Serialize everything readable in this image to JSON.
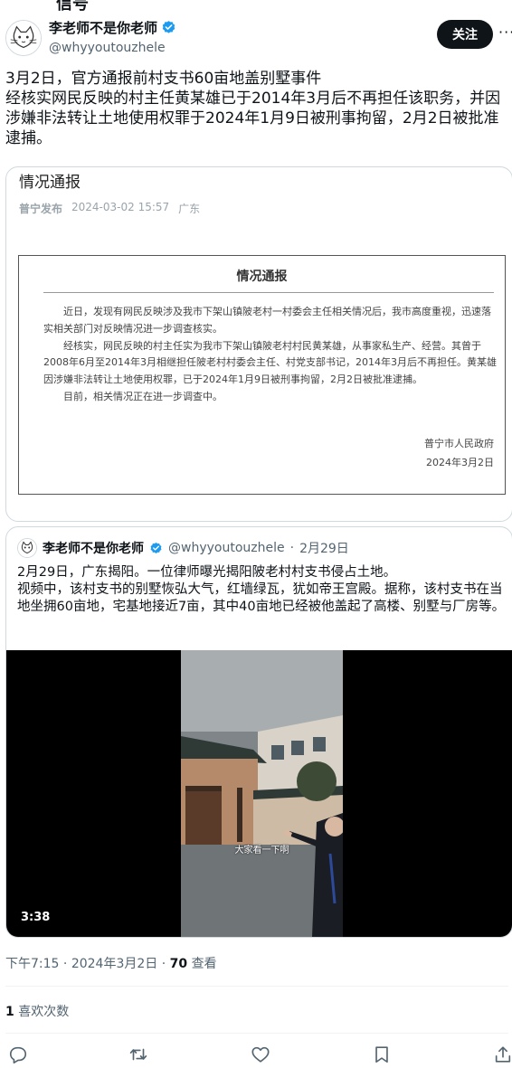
{
  "colors": {
    "text": "#0f1419",
    "secondary": "#536471",
    "verified": "#1d9bf0",
    "border": "#cfd9de"
  },
  "header_cut_text": "信号",
  "author": {
    "name": "李老师不是你老师",
    "handle": "@whyyoutouzhele",
    "verified_icon": "verified-badge-icon",
    "avatar_icon": "cat-sketch-avatar-icon"
  },
  "follow_label": "关注",
  "more_label": "···",
  "tweet_text": "3月2日，官方通报前村支书60亩地盖别墅事件\n经核实网民反映的村主任黄某雄已于2014年3月后不再担任该职务，并因涉嫌非法转让土地使用权罪于2024年1月9日被刑事拘留，2月2日被批准逮捕。",
  "card1": {
    "title": "情况通报",
    "source": "普宁发布",
    "date": "2024-03-02 15:57",
    "region": "广东",
    "notice_title": "情况通报",
    "paragraphs": [
      "近日，发现有网民反映涉及我市下架山镇陂老村一村委会主任相关情况后，我市高度重视，迅速落实相关部门对反映情况进一步调查核实。",
      "经核实，网民反映的村主任实为我市下架山镇陂老村村民黄某雄，从事家私生产、经营。其曾于2008年6月至2014年3月相继担任陂老村村委会主任、村党支部书记，2014年3月后不再担任。黄某雄因涉嫌非法转让土地使用权罪，已于2024年1月9日被刑事拘留，2月2日被批准逮捕。",
      "目前，相关情况正在进一步调查中。"
    ],
    "sign_org": "普宁市人民政府",
    "sign_date": "2024年3月2日"
  },
  "quoted": {
    "name": "李老师不是你老师",
    "handle": "@whyyoutouzhele",
    "date": "2月29日",
    "text": "2月29日，广东揭阳。一位律师曝光揭阳陂老村村支书侵占土地。\n视频中，该村支书的别墅恢弘大气，红墙绿瓦，犹如帝王宫殿。据称，该村支书在当地坐拥60亩地，宅基地接近7亩，其中40亩地已经被他盖起了高楼、别墅与厂房等。",
    "video_subtitle": "大家看一下啊",
    "video_duration": "3:38"
  },
  "meta": {
    "time": "下午7:15",
    "date": "2024年3月2日",
    "views": "70",
    "views_label": "查看"
  },
  "likes": {
    "count": "1",
    "label": "喜欢次数"
  },
  "actions": [
    {
      "icon": "reply-icon"
    },
    {
      "icon": "retweet-icon"
    },
    {
      "icon": "like-heart-icon"
    },
    {
      "icon": "bookmark-icon"
    },
    {
      "icon": "share-icon"
    }
  ]
}
